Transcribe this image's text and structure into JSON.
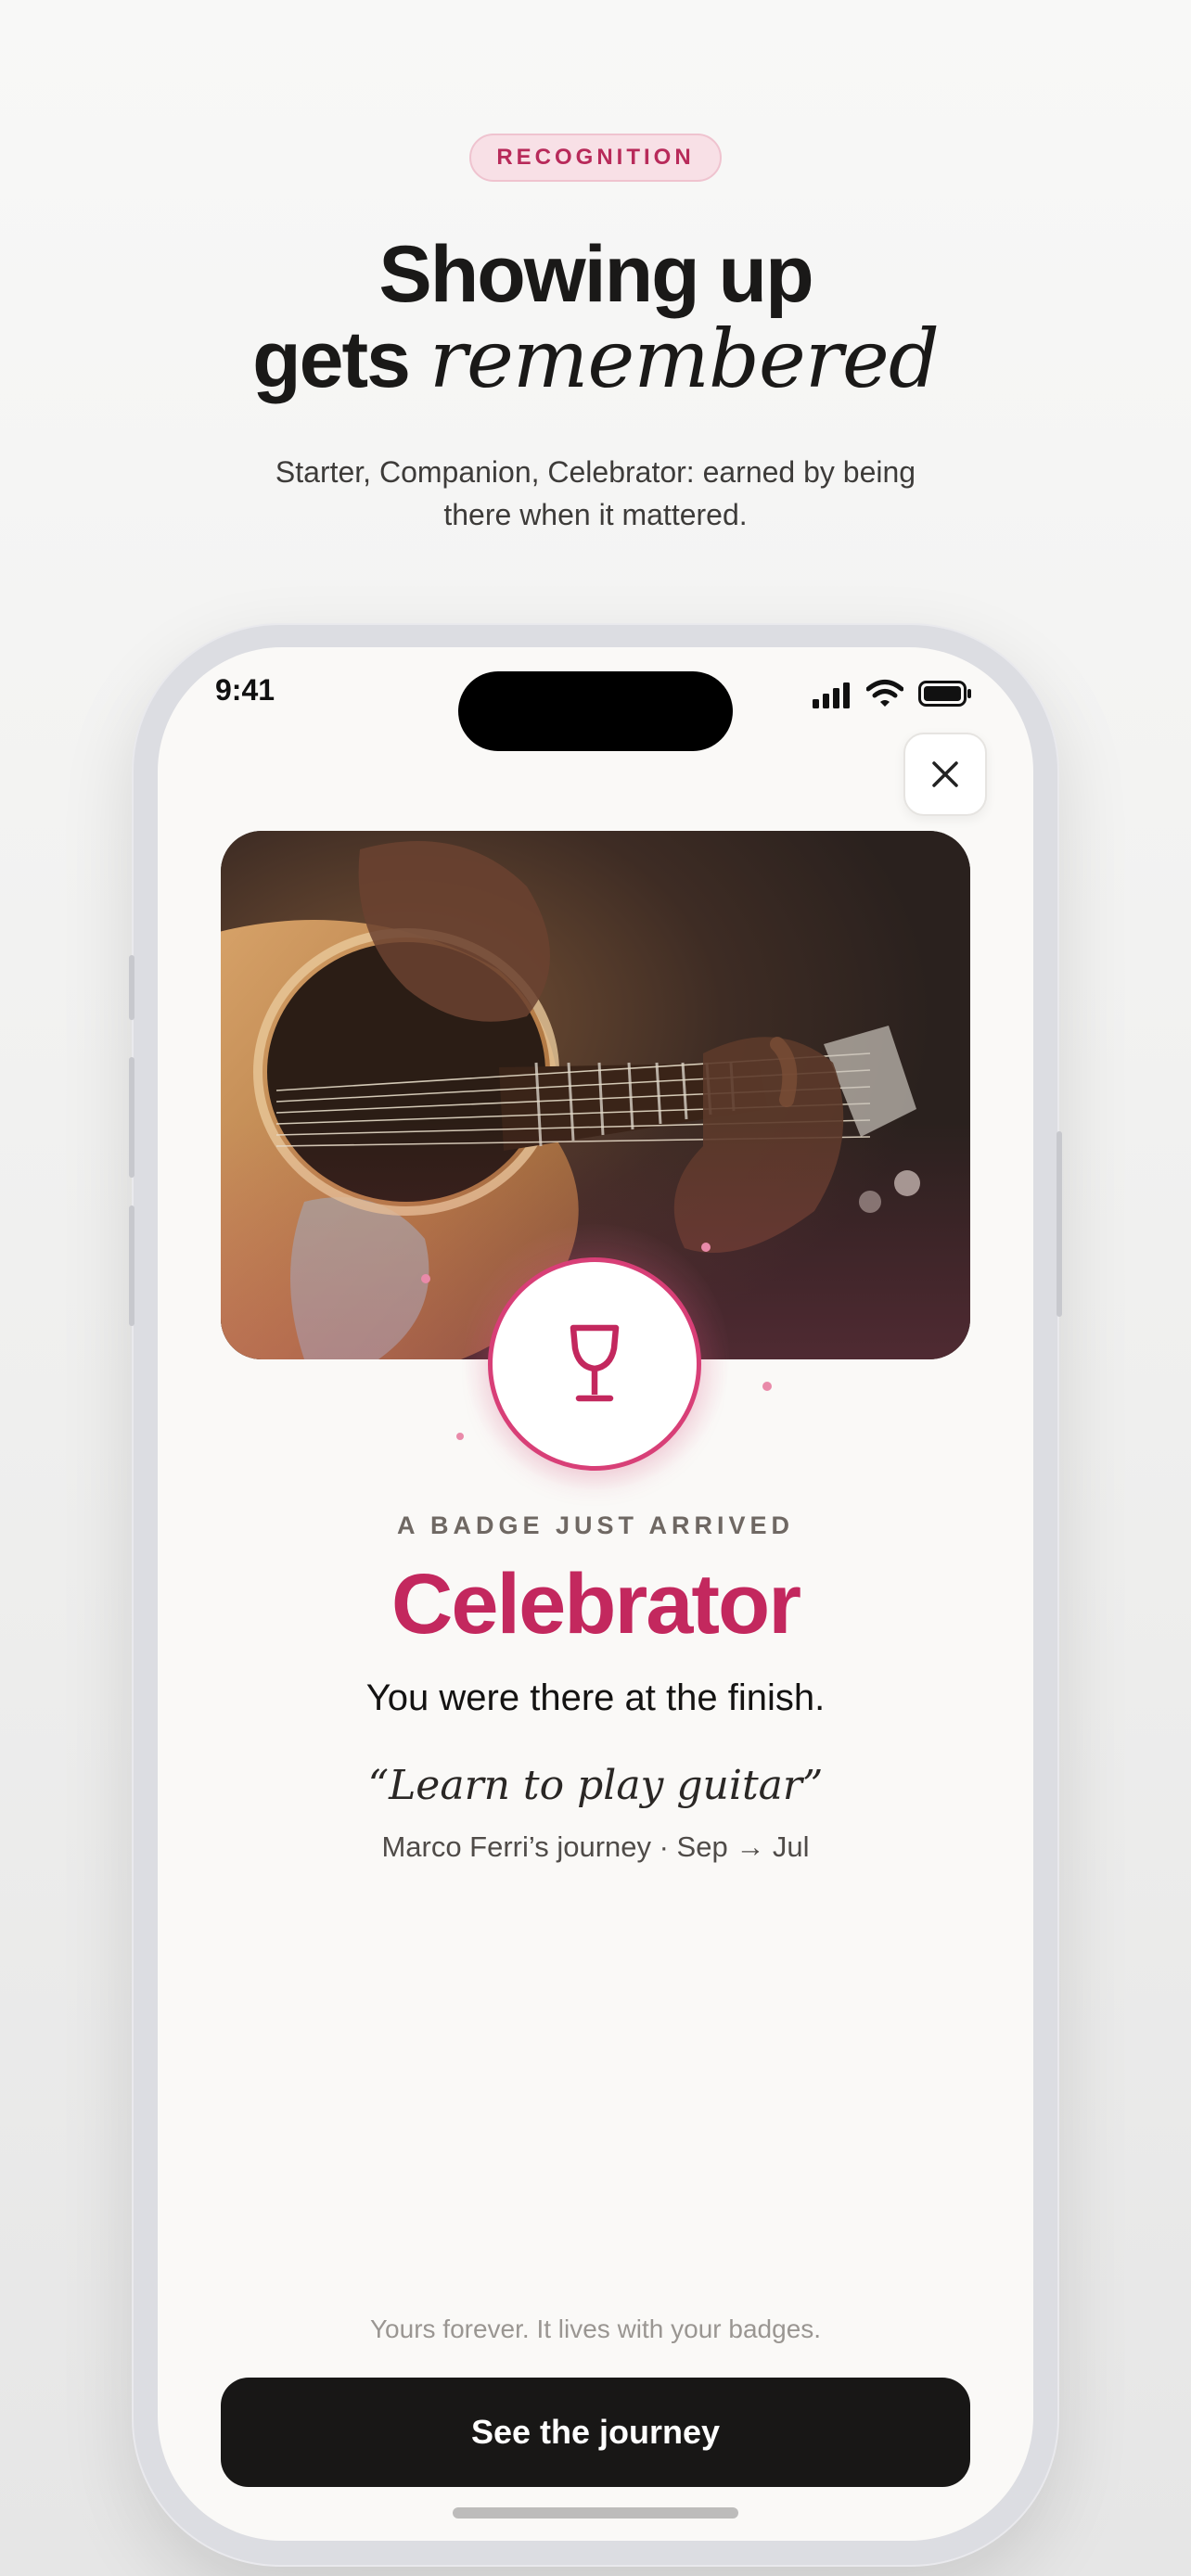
{
  "hero": {
    "eyebrow": "RECOGNITION",
    "headline_line1": "Showing up",
    "headline_line2_plain": "gets",
    "headline_line2_italic": "remembered",
    "subhead": "Starter, Companion, Celebrator: earned by being there when it mattered."
  },
  "status_bar": {
    "time": "9:41",
    "icons": [
      "cellular-signal-icon",
      "wifi-icon",
      "battery-icon"
    ]
  },
  "modal": {
    "close_icon": "close-icon",
    "photo_subject": "person playing acoustic guitar",
    "badge_icon": "wine-glass-icon",
    "eyebrow": "A BADGE JUST ARRIVED",
    "badge_name": "Celebrator",
    "tagline": "You were there at the finish.",
    "goal_quote": "“Learn to play guitar”",
    "journey_meta": "Marco Ferri’s journey · Sep → Jul",
    "footnote": "Yours forever. It lives with your badges.",
    "cta_label": "See the journey"
  },
  "colors": {
    "accent": "#c3285e",
    "badge_ring": "#d83f77",
    "pill_bg": "#f8e0e6",
    "cta_bg": "#181716",
    "page_bg": "#f4f4f3"
  }
}
